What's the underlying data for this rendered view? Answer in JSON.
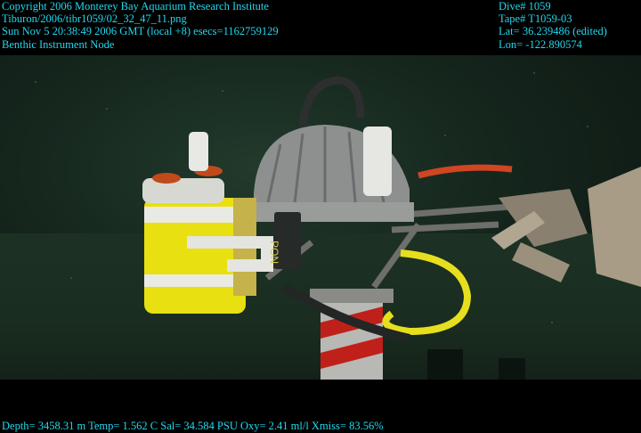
{
  "overlay": {
    "copyright": "Copyright 2006 Monterey Bay Aquarium Research Institute",
    "file_path": "Tiburon/2006/tibr1059/02_32_47_11.png",
    "timestamp": "Sun Nov  5 20:38:49 2006 GMT (local +8)  esecs=1162759129",
    "subject": "Benthic Instrument Node",
    "dive": "Dive# 1059",
    "tape": "Tape# T1059-03",
    "lat": "Lat= 36.239486 (edited)",
    "lon": "Lon= -122.890574",
    "sensors": "Depth= 3458.31 m  Temp= 1.562 C  Sal= 34.584 PSU  Oxy= 2.41 ml/l  Xmiss= 83.56%"
  },
  "colors": {
    "overlay_text": "#22d8ee",
    "background": "#000000",
    "water": "#1a2d21",
    "instrument_yellow": "#e8e010",
    "sphere_gray": "#8e9090",
    "cable_yellow": "#e7df1e",
    "pipe_red": "#c0201a",
    "arm_tan": "#a89c86"
  },
  "scene": {
    "label_on_instrument": "PON"
  }
}
